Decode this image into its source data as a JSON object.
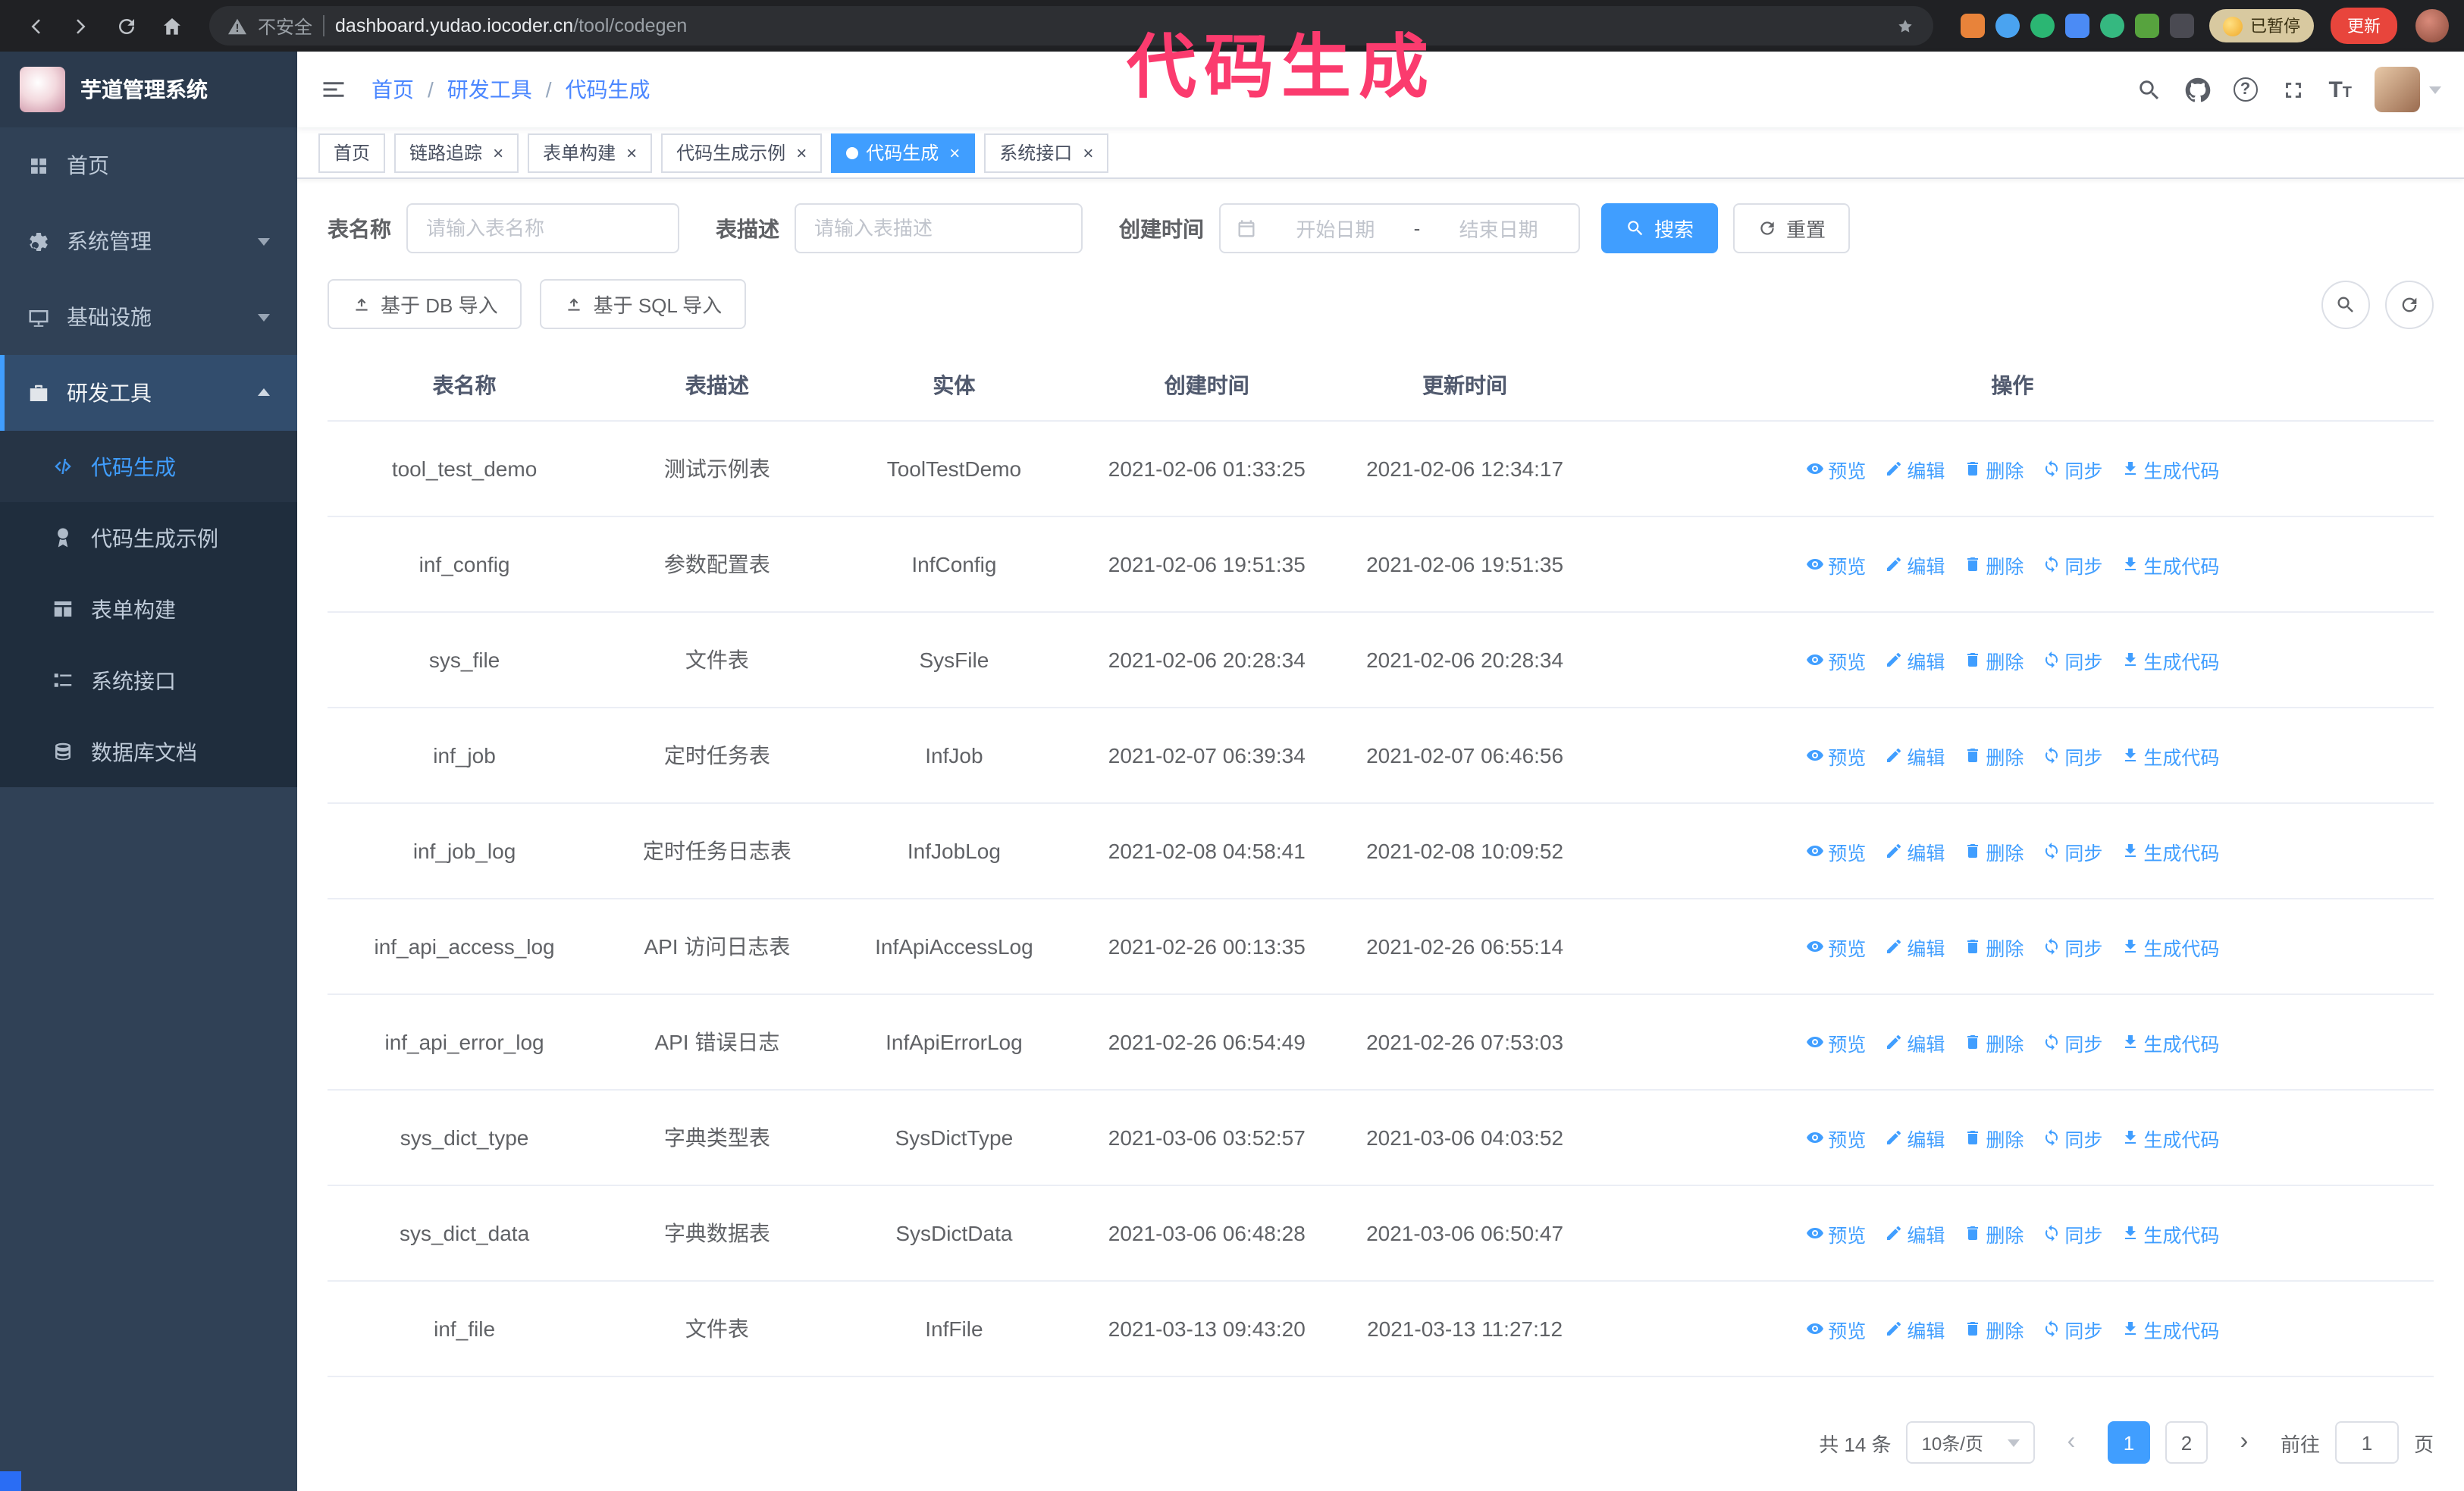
{
  "browser": {
    "security_label": "不安全",
    "url_host": "dashboard.yudao.iocoder.cn",
    "url_path": "/tool/codegen",
    "paused_badge": "已暂停",
    "update_button": "更新"
  },
  "annotation": {
    "text": "代码生成",
    "color": "#fb3b6e"
  },
  "sidebar": {
    "logo_title": "芋道管理系统",
    "items": [
      {
        "label": "首页",
        "icon": "dashboard-icon",
        "active": false,
        "chevron": ""
      },
      {
        "label": "系统管理",
        "icon": "gear-icon",
        "active": false,
        "chevron": "down"
      },
      {
        "label": "基础设施",
        "icon": "infrastructure-icon",
        "active": false,
        "chevron": "down"
      },
      {
        "label": "研发工具",
        "icon": "tools-icon",
        "active": true,
        "chevron": "up"
      }
    ],
    "sub_items": [
      {
        "label": "代码生成",
        "icon": "code-icon",
        "active": true
      },
      {
        "label": "代码生成示例",
        "icon": "example-icon",
        "active": false
      },
      {
        "label": "表单构建",
        "icon": "form-icon",
        "active": false
      },
      {
        "label": "系统接口",
        "icon": "api-icon",
        "active": false
      },
      {
        "label": "数据库文档",
        "icon": "database-icon",
        "active": false
      }
    ]
  },
  "header": {
    "breadcrumb": [
      "首页",
      "研发工具",
      "代码生成"
    ],
    "separator": "/"
  },
  "tabs": [
    {
      "label": "首页",
      "closable": false,
      "active": false
    },
    {
      "label": "链路追踪",
      "closable": true,
      "active": false
    },
    {
      "label": "表单构建",
      "closable": true,
      "active": false
    },
    {
      "label": "代码生成示例",
      "closable": true,
      "active": false
    },
    {
      "label": "代码生成",
      "closable": true,
      "active": true
    },
    {
      "label": "系统接口",
      "closable": true,
      "active": false
    }
  ],
  "filters": {
    "table_name_label": "表名称",
    "table_name_placeholder": "请输入表名称",
    "table_desc_label": "表描述",
    "table_desc_placeholder": "请输入表描述",
    "create_time_label": "创建时间",
    "start_date_placeholder": "开始日期",
    "range_separator": "-",
    "end_date_placeholder": "结束日期",
    "search_button": "搜索",
    "reset_button": "重置"
  },
  "toolbar": {
    "import_db_button": "基于 DB 导入",
    "import_sql_button": "基于 SQL 导入"
  },
  "table": {
    "columns": [
      "表名称",
      "表描述",
      "实体",
      "创建时间",
      "更新时间",
      "操作"
    ],
    "actions": [
      "预览",
      "编辑",
      "删除",
      "同步",
      "生成代码"
    ],
    "rows": [
      {
        "name": "tool_test_demo",
        "desc": "测试示例表",
        "entity": "ToolTestDemo",
        "created": "2021-02-06 01:33:25",
        "updated": "2021-02-06 12:34:17"
      },
      {
        "name": "inf_config",
        "desc": "参数配置表",
        "entity": "InfConfig",
        "created": "2021-02-06 19:51:35",
        "updated": "2021-02-06 19:51:35"
      },
      {
        "name": "sys_file",
        "desc": "文件表",
        "entity": "SysFile",
        "created": "2021-02-06 20:28:34",
        "updated": "2021-02-06 20:28:34"
      },
      {
        "name": "inf_job",
        "desc": "定时任务表",
        "entity": "InfJob",
        "created": "2021-02-07 06:39:34",
        "updated": "2021-02-07 06:46:56"
      },
      {
        "name": "inf_job_log",
        "desc": "定时任务日志表",
        "entity": "InfJobLog",
        "created": "2021-02-08 04:58:41",
        "updated": "2021-02-08 10:09:52"
      },
      {
        "name": "inf_api_access_log",
        "desc": "API 访问日志表",
        "entity": "InfApiAccessLog",
        "created": "2021-02-26 00:13:35",
        "updated": "2021-02-26 06:55:14"
      },
      {
        "name": "inf_api_error_log",
        "desc": "API 错误日志",
        "entity": "InfApiErrorLog",
        "created": "2021-02-26 06:54:49",
        "updated": "2021-02-26 07:53:03"
      },
      {
        "name": "sys_dict_type",
        "desc": "字典类型表",
        "entity": "SysDictType",
        "created": "2021-03-06 03:52:57",
        "updated": "2021-03-06 04:03:52"
      },
      {
        "name": "sys_dict_data",
        "desc": "字典数据表",
        "entity": "SysDictData",
        "created": "2021-03-06 06:48:28",
        "updated": "2021-03-06 06:50:47"
      },
      {
        "name": "inf_file",
        "desc": "文件表",
        "entity": "InfFile",
        "created": "2021-03-13 09:43:20",
        "updated": "2021-03-13 11:27:12"
      }
    ]
  },
  "pagination": {
    "total_text": "共 14 条",
    "page_size_text": "10条/页",
    "prev_label": "‹",
    "next_label": "›",
    "pages": [
      "1",
      "2"
    ],
    "active_page": "1",
    "goto_label": "前往",
    "goto_value": "1",
    "goto_suffix": "页"
  }
}
